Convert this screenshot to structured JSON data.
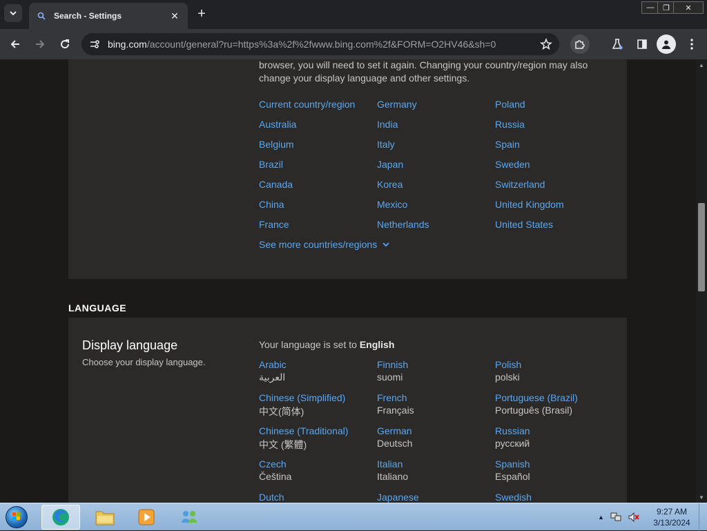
{
  "browser": {
    "tab_title": "Search - Settings",
    "tab_close": "✕",
    "new_tab": "+",
    "url_host": "bing.com",
    "url_path": "/account/general?ru=https%3a%2f%2fwww.bing.com%2f&FORM=O2HV46&sh=0",
    "window_controls": {
      "minimize": "—",
      "maximize": "❐",
      "close": "✕"
    }
  },
  "region": {
    "description": "based on your location. If you clear your cookies or use a different device or browser, you will need to set it again. Changing your country/region may also change your display language and other settings.",
    "columns": [
      [
        "Current country/region",
        "Australia",
        "Belgium",
        "Brazil",
        "Canada",
        "China",
        "France"
      ],
      [
        "Germany",
        "India",
        "Italy",
        "Japan",
        "Korea",
        "Mexico",
        "Netherlands"
      ],
      [
        "Poland",
        "Russia",
        "Spain",
        "Sweden",
        "Switzerland",
        "United Kingdom",
        "United States"
      ]
    ],
    "see_more": "See more countries/regions"
  },
  "language": {
    "section_label": "LANGUAGE",
    "title": "Display language",
    "subtitle": "Choose your display language.",
    "set_prefix": "Your language is set to ",
    "set_value": "English",
    "columns": [
      [
        {
          "en": "Arabic",
          "native": "العربية"
        },
        {
          "en": "Chinese (Simplified)",
          "native": "中文(简体)"
        },
        {
          "en": "Chinese (Traditional)",
          "native": "中文 (繁體)"
        },
        {
          "en": "Czech",
          "native": "Čeština"
        },
        {
          "en": "Dutch",
          "native": ""
        }
      ],
      [
        {
          "en": "Finnish",
          "native": "suomi"
        },
        {
          "en": "French",
          "native": "Français"
        },
        {
          "en": "German",
          "native": "Deutsch"
        },
        {
          "en": "Italian",
          "native": "Italiano"
        },
        {
          "en": "Japanese",
          "native": ""
        }
      ],
      [
        {
          "en": "Polish",
          "native": "polski"
        },
        {
          "en": "Portuguese (Brazil)",
          "native": "Português (Brasil)"
        },
        {
          "en": "Russian",
          "native": "русский"
        },
        {
          "en": "Spanish",
          "native": "Español"
        },
        {
          "en": "Swedish",
          "native": ""
        }
      ]
    ]
  },
  "taskbar": {
    "time": "9:27 AM",
    "date": "3/13/2024"
  },
  "colors": {
    "link": "#5aa7f0",
    "card": "#2b2a29",
    "page": "#1b1a19"
  }
}
